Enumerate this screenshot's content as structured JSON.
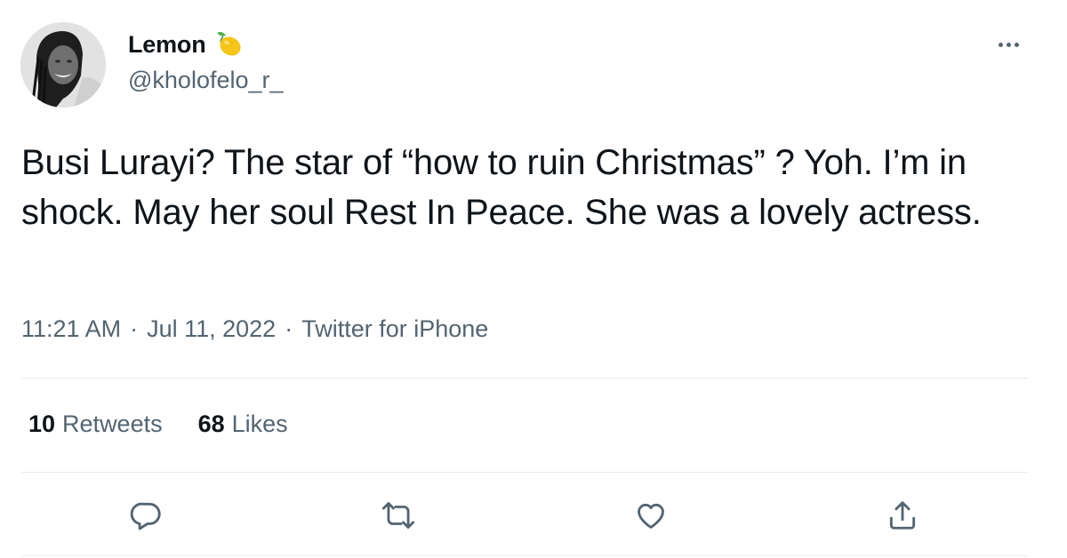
{
  "author": {
    "display_name": "Lemon",
    "emoji_icon": "lemon-icon",
    "handle": "@kholofelo_r_"
  },
  "tweet": {
    "text": "Busi Lurayi? The star of “how to ruin Christmas” ? Yoh. I’m in shock. May her soul Rest In Peace. She was a lovely actress."
  },
  "meta": {
    "time": "11:21 AM",
    "separator": "·",
    "date": "Jul 11, 2022",
    "source": "Twitter for iPhone"
  },
  "stats": {
    "retweets_count": "10",
    "retweets_label": "Retweets",
    "likes_count": "68",
    "likes_label": "Likes"
  },
  "actions": [
    "reply-icon",
    "retweet-icon",
    "like-icon",
    "share-icon"
  ],
  "colors": {
    "text_primary": "#0f1419",
    "text_secondary": "#536471",
    "divider": "#e6ecf0",
    "lemon": "#f5c518"
  }
}
